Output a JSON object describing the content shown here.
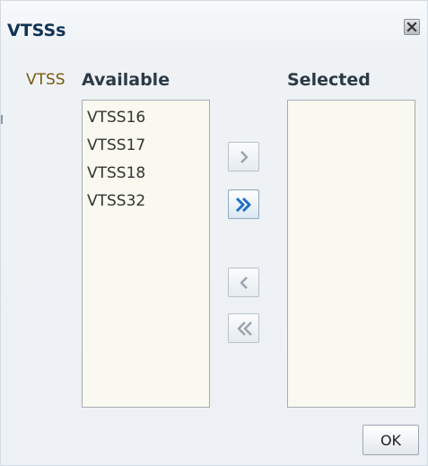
{
  "dialog": {
    "title": "VTSSs",
    "close_icon": "close-x-icon"
  },
  "shuttle": {
    "field_label": "VTSS",
    "available": {
      "header": "Available",
      "items": [
        "VTSS16",
        "VTSS17",
        "VTSS18",
        "VTSS32"
      ]
    },
    "selected": {
      "header": "Selected",
      "items": []
    },
    "buttons": {
      "move": "chevron-right-icon",
      "move_all": "double-chevron-right-icon",
      "remove": "chevron-left-icon",
      "remove_all": "double-chevron-left-icon"
    }
  },
  "footer": {
    "ok_label": "OK"
  },
  "colors": {
    "title": "#113355",
    "field_label": "#7a5a0c",
    "list_background": "#f9f9ef",
    "active_arrow": "#1f6fc6",
    "disabled_arrow": "#9aa4ad"
  }
}
